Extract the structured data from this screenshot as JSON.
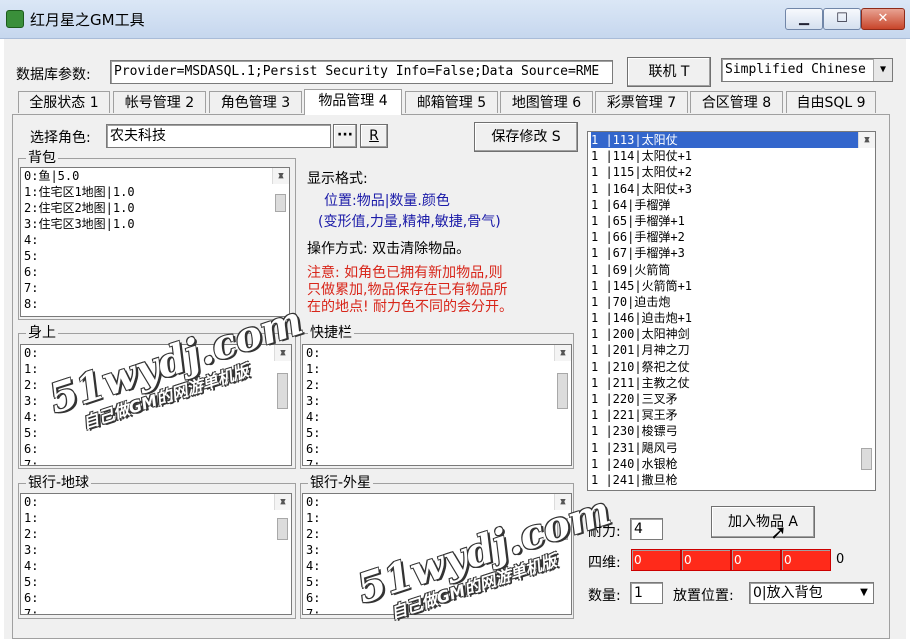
{
  "window": {
    "title": "红月星之GM工具",
    "minimize_glyph": "▁",
    "maximize_glyph": "☐",
    "close_glyph": "✕"
  },
  "db": {
    "label": "数据库参数:",
    "connection_string": "Provider=MSDASQL.1;Persist Security Info=False;Data Source=RME",
    "connect_button": "联机 T",
    "language": "Simplified Chinese"
  },
  "tabs": [
    {
      "label": "全服状态 1"
    },
    {
      "label": "帐号管理 2"
    },
    {
      "label": "角色管理 3"
    },
    {
      "label": "物品管理 4",
      "active": true
    },
    {
      "label": "邮箱管理 5"
    },
    {
      "label": "地图管理 6"
    },
    {
      "label": "彩票管理 7"
    },
    {
      "label": "合区管理 8"
    },
    {
      "label": "自由SQL 9"
    }
  ],
  "role": {
    "label": "选择角色:",
    "value": "农夫科技",
    "browse_button": "···",
    "r_button": "R",
    "save_button": "保存修改 S"
  },
  "backpack": {
    "title": "背包",
    "rows": [
      "0:鱼|5.0",
      "1:住宅区1地图|1.0",
      "2:住宅区2地图|1.0",
      "3:住宅区3地图|1.0",
      "4:",
      "5:",
      "6:",
      "7:",
      "8:"
    ]
  },
  "help": {
    "format_title": "显示格式:",
    "format_line1": "位置:物品|数量.颜色",
    "format_line2": "(变形值,力量,精神,敏捷,骨气)",
    "op_title": "操作方式: 双击清除物品。",
    "note_line1": "注意: 如角色已拥有新加物品,则",
    "note_line2": "只做累加,物品保存在已有物品所",
    "note_line3": "在的地点! 耐力色不同的会分开。"
  },
  "body_slots": {
    "title": "身上",
    "rows": [
      "0:",
      "1:",
      "2:",
      "3:",
      "4:",
      "5:",
      "6:",
      "7:"
    ]
  },
  "shortcut": {
    "title": "快捷栏",
    "rows": [
      "0:",
      "1:",
      "2:",
      "3:",
      "4:",
      "5:",
      "6:",
      "7:"
    ]
  },
  "bank_earth": {
    "title": "银行-地球",
    "rows": [
      "0:",
      "1:",
      "2:",
      "3:",
      "4:",
      "5:",
      "6:",
      "7:"
    ]
  },
  "bank_outer": {
    "title": "银行-外星",
    "rows": [
      "0:",
      "1:",
      "2:",
      "3:",
      "4:",
      "5:",
      "6:",
      "7:"
    ]
  },
  "items": [
    {
      "text": "1 |113|太阳仗",
      "selected": true
    },
    {
      "text": "1 |114|太阳仗+1"
    },
    {
      "text": "1 |115|太阳仗+2"
    },
    {
      "text": "1 |164|太阳仗+3"
    },
    {
      "text": "1 |64|手榴弹"
    },
    {
      "text": "1 |65|手榴弹+1"
    },
    {
      "text": "1 |66|手榴弹+2"
    },
    {
      "text": "1 |67|手榴弹+3"
    },
    {
      "text": "1 |69|火箭筒"
    },
    {
      "text": "1 |145|火箭筒+1"
    },
    {
      "text": "1 |70|迫击炮"
    },
    {
      "text": "1 |146|迫击炮+1"
    },
    {
      "text": "1 |200|太阳神剑"
    },
    {
      "text": "1 |201|月神之刀"
    },
    {
      "text": "1 |210|祭祀之仗"
    },
    {
      "text": "1 |211|主教之仗"
    },
    {
      "text": "1 |220|三叉矛"
    },
    {
      "text": "1 |221|冥王矛"
    },
    {
      "text": "1 |230|梭镖弓"
    },
    {
      "text": "1 |231|飓风弓"
    },
    {
      "text": "1 |240|水银枪"
    },
    {
      "text": "1 |241|撒旦枪"
    }
  ],
  "add_item": {
    "button": "加入物品 A",
    "durability_label": "耐力:",
    "durability_value": "4",
    "stats_label": "四维:",
    "stats_values": [
      "0",
      "0",
      "0",
      "0"
    ],
    "stats_trailing": "0",
    "stats_color": "#ff2a1a",
    "quantity_label": "数量:",
    "quantity_value": "1",
    "place_label": "放置位置:",
    "place_value": "0|放入背包"
  },
  "watermark": {
    "site": "51wydj.com",
    "slogan": "自己做GM的网游单机版"
  },
  "colors": {
    "selection": "#3366cc",
    "format_text": "#1a1aa8",
    "note_text": "#d8261a"
  }
}
